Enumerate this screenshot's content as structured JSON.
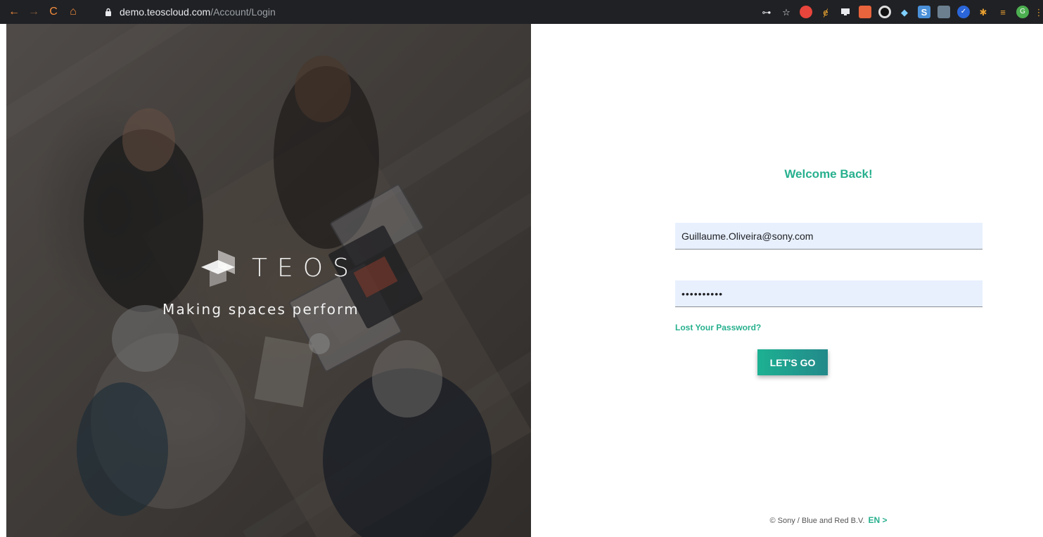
{
  "browser": {
    "url_host": "demo.teoscloud.com",
    "url_path": "/Account/Login",
    "back_icon": "←",
    "forward_icon": "→",
    "reload_icon": "C",
    "home_icon": "⌂",
    "key_icon": "⊶",
    "star_icon": "☆",
    "profile_initial": "G",
    "menu_icon": "⋮"
  },
  "hero": {
    "brand_name": "TEOS",
    "tagline": "Making spaces perform"
  },
  "login": {
    "title": "Welcome Back!",
    "email_value": "Guillaume.Oliveira@sony.com",
    "password_mask": "••••••••••",
    "lost_password": "Lost Your Password?",
    "submit_label": "LET'S GO"
  },
  "footer": {
    "copyright": "© Sony / Blue and Red B.V.",
    "language": "EN >"
  },
  "colors": {
    "accent": "#27b08e",
    "button_start": "#1db192",
    "button_end": "#23898a",
    "input_bg": "#e8f0fe",
    "chrome_bg": "#202124"
  }
}
